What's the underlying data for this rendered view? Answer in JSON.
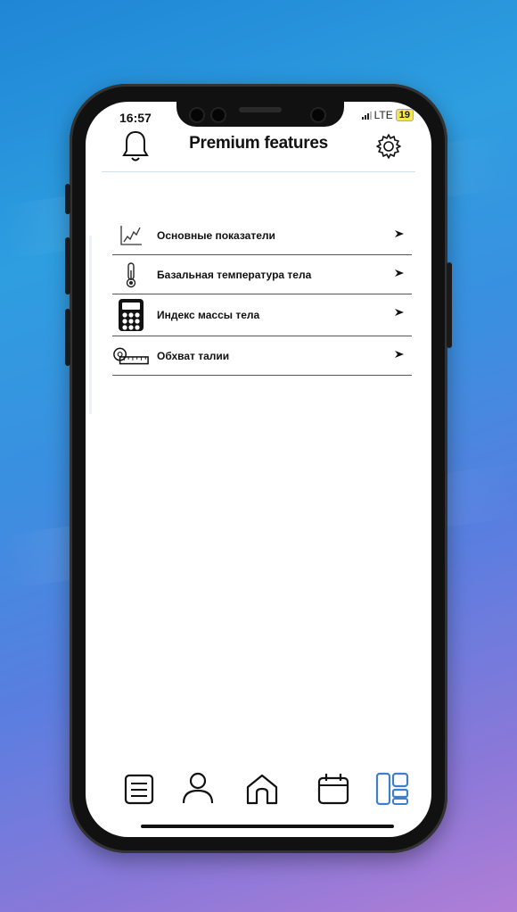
{
  "status_bar": {
    "time": "16:57",
    "network": "LTE",
    "battery": "19"
  },
  "header": {
    "title": "Premium features"
  },
  "menu": {
    "items": [
      {
        "label": "Основные показатели",
        "icon": "chart-line-icon"
      },
      {
        "label": "Базальная температура тела",
        "icon": "thermometer-icon"
      },
      {
        "label": "Индекс массы тела",
        "icon": "calculator-icon"
      },
      {
        "label": "Обхват талии",
        "icon": "tape-measure-icon"
      }
    ]
  },
  "tabbar": {
    "items": [
      {
        "icon": "list-icon"
      },
      {
        "icon": "profile-icon"
      },
      {
        "icon": "home-icon"
      },
      {
        "icon": "calendar-icon"
      },
      {
        "icon": "dashboard-icon",
        "active": true
      }
    ]
  },
  "colors": {
    "active_tab": "#3f7fc9",
    "icon": "#111111",
    "header_line": "#cfe0ee"
  }
}
